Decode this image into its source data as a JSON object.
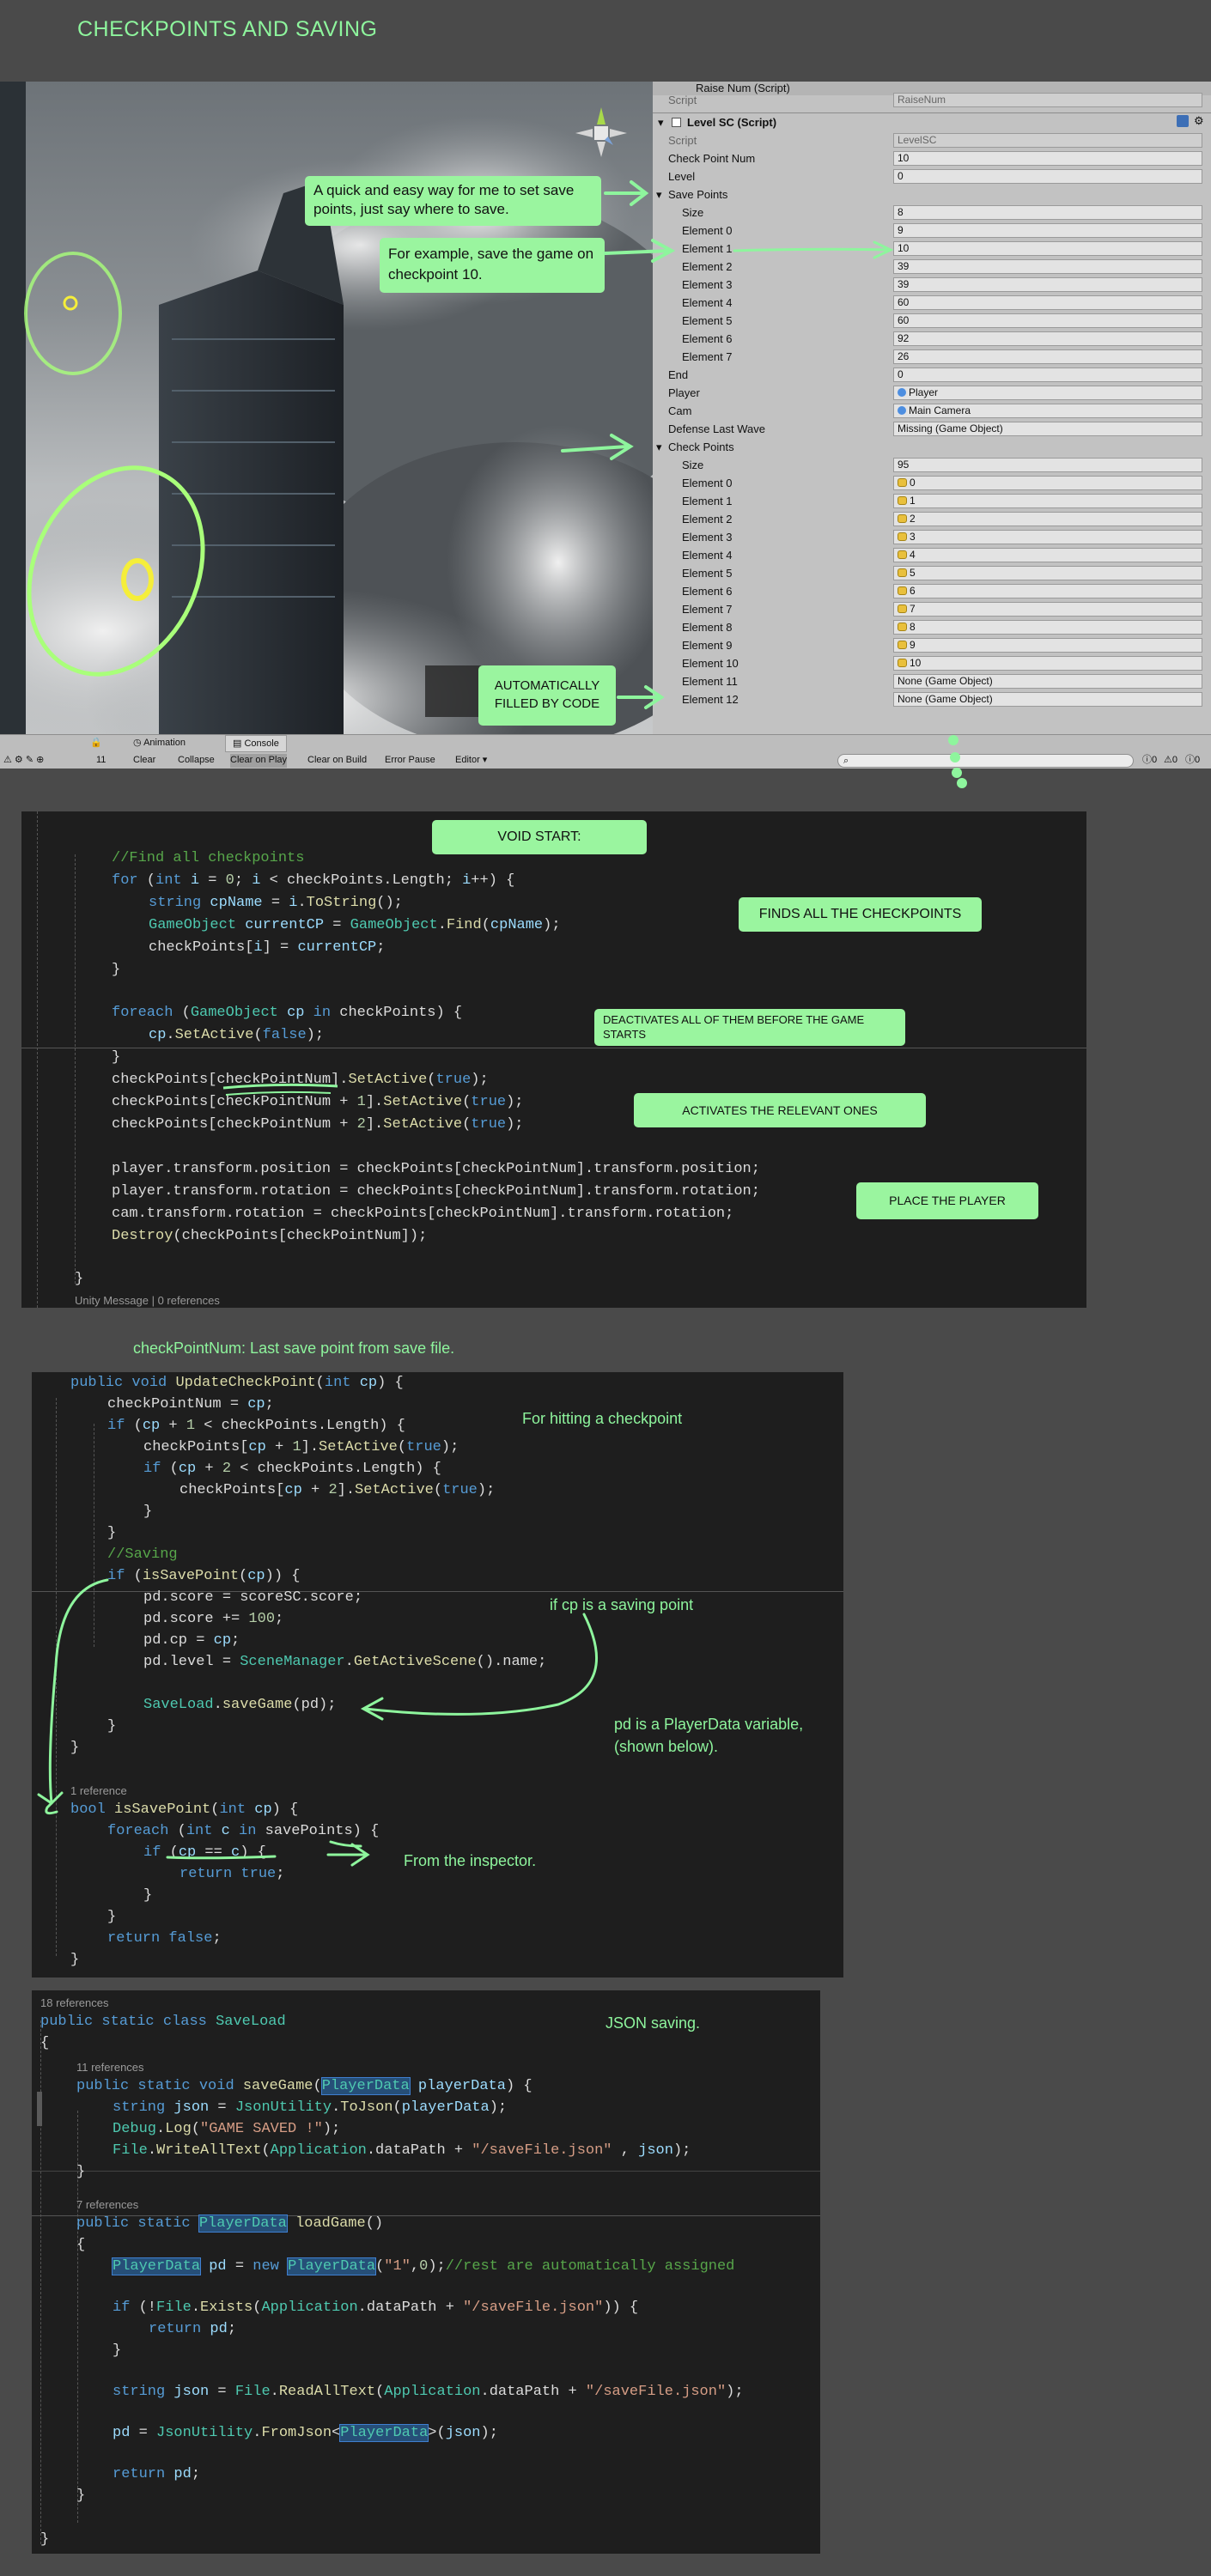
{
  "page_title": "CHECKPOINTS AND SAVING",
  "colors": {
    "accent": "#8ef59d",
    "callout_bg": "#9af59f",
    "code_bg": "#1e1e1e"
  },
  "inspector": {
    "raise_num": {
      "header": "Raise Num (Script)",
      "script_label": "Script",
      "script_value": "RaiseNum"
    },
    "level_sc": {
      "header": "Level SC (Script)",
      "script_label": "Script",
      "script_value": "LevelSC",
      "check_point_num_label": "Check Point Num",
      "check_point_num_value": "10",
      "level_label": "Level",
      "level_value": "0",
      "save_points_label": "Save Points",
      "save_points_size_label": "Size",
      "save_points_size_value": "8",
      "save_points": [
        {
          "label": "Element 0",
          "value": "9"
        },
        {
          "label": "Element 1",
          "value": "10"
        },
        {
          "label": "Element 2",
          "value": "39"
        },
        {
          "label": "Element 3",
          "value": "39"
        },
        {
          "label": "Element 4",
          "value": "60"
        },
        {
          "label": "Element 5",
          "value": "60"
        },
        {
          "label": "Element 6",
          "value": "92"
        },
        {
          "label": "Element 7",
          "value": "26"
        }
      ],
      "end_label": "End",
      "end_value": "0",
      "player_label": "Player",
      "player_value": "Player",
      "cam_label": "Cam",
      "cam_value": "Main Camera",
      "defense_label": "Defense Last Wave",
      "defense_value": "Missing (Game Object)",
      "check_points_label": "Check Points",
      "check_points_size_label": "Size",
      "check_points_size_value": "95",
      "check_points": [
        {
          "label": "Element 0",
          "value": "0"
        },
        {
          "label": "Element 1",
          "value": "1"
        },
        {
          "label": "Element 2",
          "value": "2"
        },
        {
          "label": "Element 3",
          "value": "3"
        },
        {
          "label": "Element 4",
          "value": "4"
        },
        {
          "label": "Element 5",
          "value": "5"
        },
        {
          "label": "Element 6",
          "value": "6"
        },
        {
          "label": "Element 7",
          "value": "7"
        },
        {
          "label": "Element 8",
          "value": "8"
        },
        {
          "label": "Element 9",
          "value": "9"
        },
        {
          "label": "Element 10",
          "value": "10"
        },
        {
          "label": "Element 11",
          "value": "None (Game Object)"
        },
        {
          "label": "Element 12",
          "value": "None (Game Object)"
        }
      ]
    }
  },
  "bottom_toolbar": {
    "tabs": [
      "Animation",
      "Console"
    ],
    "buttons": [
      "Clear",
      "Collapse",
      "Clear on Play",
      "Clear on Build",
      "Error Pause",
      "Editor"
    ],
    "count": "11",
    "counters": [
      "0",
      "0",
      "0"
    ]
  },
  "callouts": {
    "save_points_note": "A quick and easy way for me to set save points, just say where to save.",
    "example_note": "For example, save the game on checkpoint 10.",
    "auto_fill": "AUTOMATICALLY FILLED BY CODE",
    "void_start": "VOID START:",
    "finds_all": "FINDS ALL THE CHECKPOINTS",
    "deactivates": "DEACTIVATES ALL OF THEM BEFORE THE GAME STARTS",
    "activates": "ACTIVATES THE RELEVANT ONES",
    "place_player": "PLACE THE PLAYER"
  },
  "notes": {
    "checkpointnum": "checkPointNum: Last save point from save file.",
    "hitting": "For hitting a checkpoint",
    "if_saving": "if cp is a saving point",
    "pd_line1": "pd is a PlayerData variable,",
    "pd_line2": "(shown below).",
    "from_inspector": "From the inspector.",
    "json_saving": "JSON saving."
  },
  "code_start": {
    "footer": "Unity Message | 0 references"
  },
  "code_update": {
    "ref_label": "1 reference"
  },
  "code_saveload": {
    "refs_top": "18 references",
    "refs_save": "11 references",
    "refs_load": "7 references"
  }
}
